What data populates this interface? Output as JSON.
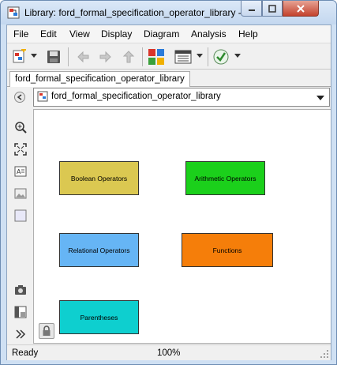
{
  "window": {
    "title": "Library: ford_formal_specification_operator_library - ..."
  },
  "menu": [
    "File",
    "Edit",
    "View",
    "Display",
    "Diagram",
    "Analysis",
    "Help"
  ],
  "tab": {
    "label": "ford_formal_specification_operator_library"
  },
  "address": {
    "path": "ford_formal_specification_operator_library"
  },
  "blocks": [
    {
      "label": "Boolean Operators",
      "color": "#dbc851"
    },
    {
      "label": "Arithmetic Operators",
      "color": "#1bd01b"
    },
    {
      "label": "Relational Operators",
      "color": "#66b5f5"
    },
    {
      "label": "Functions",
      "color": "#f57e0a"
    },
    {
      "label": "Parentheses",
      "color": "#0ecfcf"
    }
  ],
  "status": {
    "text": "Ready",
    "zoom": "100%"
  },
  "icons": {
    "title": "simulink-library-icon",
    "close": "close-icon"
  }
}
